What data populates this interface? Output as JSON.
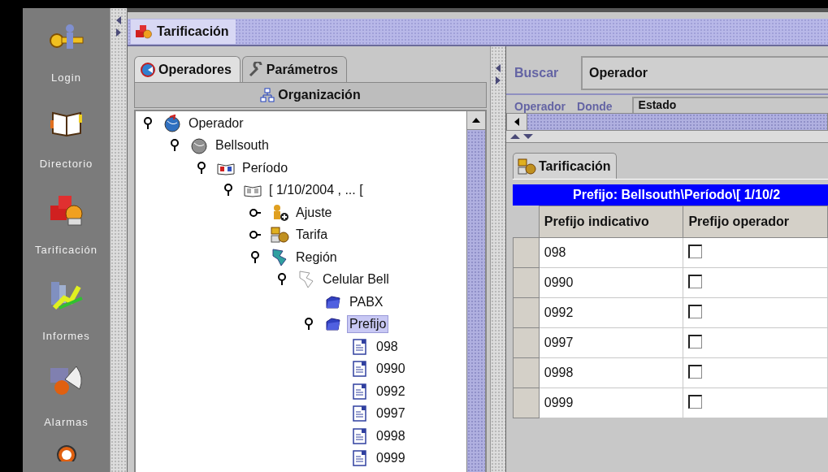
{
  "window": {
    "title": "Tarificación"
  },
  "sidebar": {
    "items": [
      {
        "label": "Login",
        "kind": "login"
      },
      {
        "label": "Directorio",
        "kind": "directory"
      },
      {
        "label": "Tarificación",
        "kind": "billing"
      },
      {
        "label": "Informes",
        "kind": "reports"
      },
      {
        "label": "Alarmas",
        "kind": "alarms"
      }
    ]
  },
  "left_panel": {
    "tabs": [
      {
        "label": "Operadores",
        "kind": "operators",
        "selected": true
      },
      {
        "label": "Parámetros",
        "kind": "parameters",
        "selected": false
      }
    ],
    "view_header": "Organización",
    "tree": [
      {
        "label": "Operador",
        "kind": "operator",
        "expanded": true,
        "selected": false,
        "children": [
          {
            "label": "Bellsouth",
            "kind": "company",
            "expanded": true,
            "selected": false,
            "children": [
              {
                "label": "Período",
                "kind": "period",
                "expanded": true,
                "selected": false,
                "children": [
                  {
                    "label": "[ 1/10/2004 , ... [",
                    "kind": "period-range",
                    "expanded": true,
                    "selected": false,
                    "children": [
                      {
                        "label": "Ajuste",
                        "kind": "adjustment",
                        "expanded": false,
                        "selected": false
                      },
                      {
                        "label": "Tarifa",
                        "kind": "rate",
                        "expanded": false,
                        "selected": false
                      },
                      {
                        "label": "Región",
                        "kind": "region",
                        "expanded": true,
                        "selected": false,
                        "children": [
                          {
                            "label": "Celular Bell",
                            "kind": "zone",
                            "expanded": true,
                            "selected": false,
                            "children": [
                              {
                                "label": "PABX",
                                "kind": "folder",
                                "selected": false
                              },
                              {
                                "label": "Prefijo",
                                "kind": "folder",
                                "expanded": true,
                                "selected": true,
                                "children": [
                                  {
                                    "label": "098",
                                    "kind": "prefix",
                                    "selected": false
                                  },
                                  {
                                    "label": "0990",
                                    "kind": "prefix",
                                    "selected": false
                                  },
                                  {
                                    "label": "0992",
                                    "kind": "prefix",
                                    "selected": false
                                  },
                                  {
                                    "label": "0997",
                                    "kind": "prefix",
                                    "selected": false
                                  },
                                  {
                                    "label": "0998",
                                    "kind": "prefix",
                                    "selected": false
                                  },
                                  {
                                    "label": "0999",
                                    "kind": "prefix",
                                    "selected": false
                                  }
                                ]
                              }
                            ]
                          }
                        ]
                      }
                    ]
                  }
                ]
              }
            ]
          }
        ]
      }
    ]
  },
  "right_panel": {
    "search": {
      "label": "Buscar",
      "value": "Operador"
    },
    "filter": {
      "labels": [
        "Operador",
        "Donde"
      ],
      "value": "Estado"
    },
    "tabs": [
      {
        "label": "Tarificación",
        "selected": true
      }
    ],
    "caption": "Prefijo:  Bellsouth\\Período\\[ 1/10/2",
    "table": {
      "columns": [
        "Prefijo indicativo",
        "Prefijo operador"
      ],
      "rows": [
        {
          "prefix": "098",
          "checked": false
        },
        {
          "prefix": "0990",
          "checked": false
        },
        {
          "prefix": "0992",
          "checked": false
        },
        {
          "prefix": "0997",
          "checked": false
        },
        {
          "prefix": "0998",
          "checked": false
        },
        {
          "prefix": "0999",
          "checked": false
        }
      ]
    }
  }
}
